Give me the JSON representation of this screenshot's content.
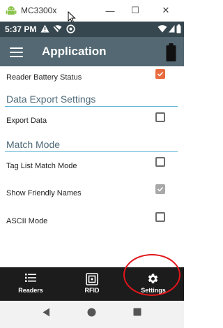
{
  "window": {
    "title": "MC3300x",
    "minimize_glyph": "—",
    "maximize_glyph": "☐",
    "close_glyph": "✕"
  },
  "status_bar": {
    "time": "5:37 PM",
    "icons": [
      "alert-icon",
      "wifi-off-icon",
      "nfc-icon",
      "wifi-icon",
      "signal-icon",
      "battery-status-icon"
    ]
  },
  "app_bar": {
    "title": "Application",
    "menu_icon": "hamburger-menu-icon",
    "battery_icon": "reader-battery-icon"
  },
  "settings": {
    "reader_battery_status": {
      "label": "Reader Battery Status",
      "checked": true
    },
    "data_export_header": "Data Export Settings",
    "export_data": {
      "label": "Export Data",
      "checked": false
    },
    "match_mode_header": "Match Mode",
    "tag_list_match_mode": {
      "label": "Tag List Match Mode",
      "checked": false
    },
    "show_friendly_names": {
      "label": "Show Friendly Names",
      "checked": true
    },
    "ascii_mode": {
      "label": "ASCII Mode",
      "checked": false
    }
  },
  "bottom_nav": {
    "items": [
      {
        "label": "Readers",
        "icon": "list-icon"
      },
      {
        "label": "RFID",
        "icon": "rfid-icon"
      },
      {
        "label": "Settings",
        "icon": "gear-icon"
      }
    ]
  },
  "system_nav": {
    "buttons": [
      "back-icon",
      "home-icon",
      "recents-icon"
    ]
  },
  "colors": {
    "status_bar": "#37474f",
    "app_bar": "#536872",
    "accent_orange": "#e96b3f",
    "section_header": "#4f6a79",
    "section_line": "#62b6d8",
    "bottom_nav": "#1c1c1c",
    "highlight_circle": "#e0161b"
  }
}
